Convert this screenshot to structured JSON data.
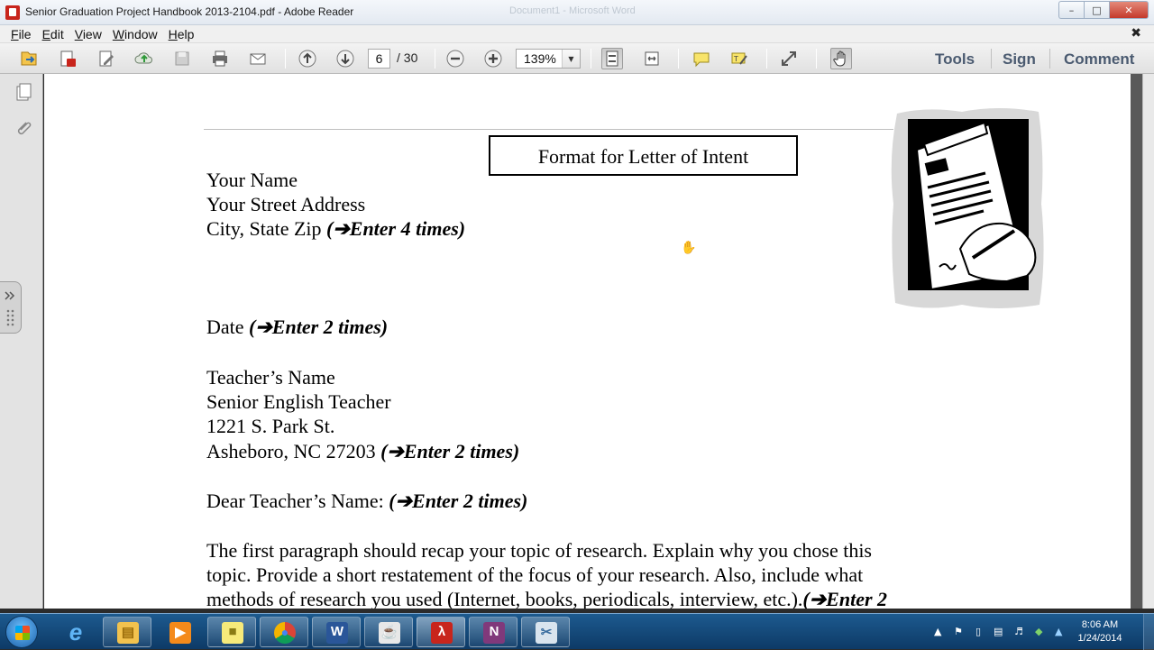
{
  "window": {
    "title": "Senior Graduation Project Handbook 2013-2104.pdf - Adobe Reader",
    "background_title": "Document1 - Microsoft Word"
  },
  "menu": [
    "File",
    "Edit",
    "View",
    "Window",
    "Help"
  ],
  "toolbar": {
    "page_current": "6",
    "page_total": "/ 30",
    "zoom": "139%",
    "links": [
      "Tools",
      "Sign",
      "Comment"
    ]
  },
  "document": {
    "heading": "Format for Letter of Intent",
    "lines": [
      {
        "text": "Your Name",
        "inst": ""
      },
      {
        "text": "Your Street Address",
        "inst": ""
      },
      {
        "text": "City, State Zip ",
        "inst": "(➔Enter 4 times)"
      },
      {
        "text": "Date ",
        "inst": "(➔Enter 2 times)"
      },
      {
        "text": "Teacher’s Name",
        "inst": ""
      },
      {
        "text": "Senior English Teacher",
        "inst": ""
      },
      {
        "text": "1221 S. Park St.",
        "inst": ""
      },
      {
        "text": "Asheboro, NC 27203 ",
        "inst": "(➔Enter 2 times)"
      },
      {
        "text": "Dear Teacher’s Name:  ",
        "inst": "(➔Enter 2 times)"
      },
      {
        "text": "The first paragraph should recap your topic of research.  Explain why you chose this",
        "inst": ""
      },
      {
        "text": "topic. Provide a short restatement of the focus of your research.  Also, include what",
        "inst": ""
      },
      {
        "text": "methods of research you used (Internet, books, periodicals, interview, etc.).",
        "inst": "(➔Enter 2"
      }
    ]
  },
  "taskbar": {
    "apps": [
      "internet-explorer",
      "windows-explorer",
      "media-player",
      "sticky-notes",
      "chrome",
      "word",
      "java",
      "adobe-reader",
      "onenote",
      "snipping-tool"
    ],
    "time": "8:06 AM",
    "date": "1/24/2014"
  },
  "colors": {
    "reader_red": "#c8251c",
    "taskbar_blue": "#1d5a8f",
    "link_slate": "#4a5a70"
  }
}
